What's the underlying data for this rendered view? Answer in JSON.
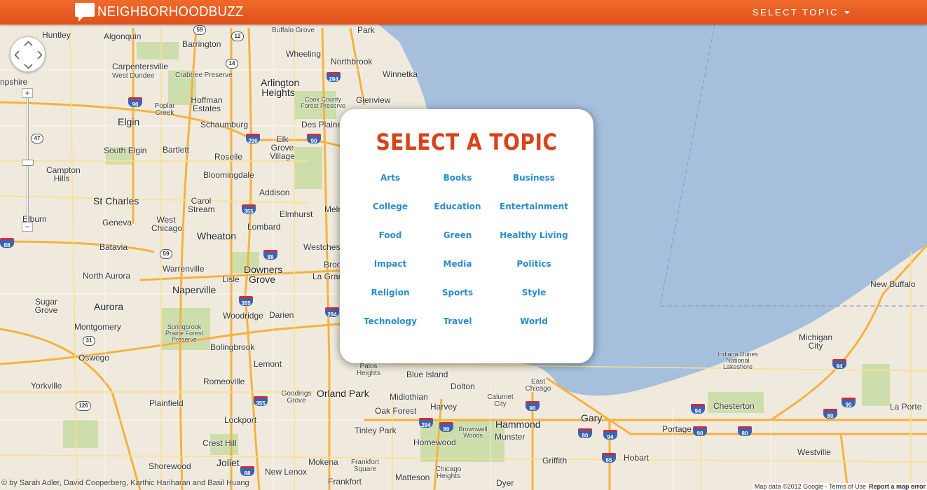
{
  "header": {
    "brand": "NEIGHBORHOODBUZZ",
    "topic_menu_label": "SELECT TOPIC"
  },
  "modal": {
    "title": "SELECT A TOPIC",
    "topics": [
      "Arts",
      "Books",
      "Business",
      "College",
      "Education",
      "Entertainment",
      "Food",
      "Green",
      "Healthy Living",
      "Impact",
      "Media",
      "Politics",
      "Religion",
      "Sports",
      "Style",
      "Technology",
      "Travel",
      "World"
    ]
  },
  "map": {
    "zoom_in_label": "+",
    "zoom_out_label": "−",
    "places": [
      "Huntley",
      "Algonquin",
      "Barrington",
      "Buffalo Grove",
      "Wheeling",
      "Northbrook",
      "Winnetka",
      "Glenview",
      "Park",
      "Carpentersville",
      "West Dundee",
      "Crabtree Preserve",
      "Arlington Heights",
      "Hoffman Estates",
      "Poplar Creek",
      "Cook County Forest Preserve",
      "Des Plaines",
      "npshire",
      "Elgin",
      "Schaumburg",
      "Elk Grove Village",
      "South Elgin",
      "Bartlett",
      "Roselle",
      "Campton Hills",
      "Bloomingdale",
      "Addison",
      "St Charles",
      "Carol Stream",
      "Elmhurst",
      "Melr",
      "Geneva",
      "West Chicago",
      "Lombard",
      "Elburn",
      "Wheaton",
      "Batavia",
      "Westches",
      "Warrenville",
      "Downers Grove",
      "Broo",
      "North Aurora",
      "Naperville",
      "Lisle",
      "La Gran",
      "Sugar Grove",
      "Aurora",
      "Woodridge",
      "Darien",
      "Montgomery",
      "Springbrook Prairie Forest Preserve",
      "Bolingbrook",
      "Oswego",
      "Lemont",
      "Palos Heights",
      "Blue Island",
      "Dolton",
      "Yorkville",
      "Romeoville",
      "Goodings Grove",
      "Orland Park",
      "Midlothian",
      "Calumet City",
      "East Chicago",
      "Plainfield",
      "Oak Forest",
      "Harvey",
      "Lockport",
      "Tinley Park",
      "Brownwell Woods",
      "Hammond",
      "Gary",
      "Homewood",
      "Munster",
      "Crest Hill",
      "Joliet",
      "Shorewood",
      "Mokena",
      "Frankfort Square",
      "Chicago Heights",
      "New Lenox",
      "Frankfort",
      "Matteson",
      "Dyer",
      "Griffith",
      "Hobart",
      "Portage",
      "Chesterton",
      "Westville",
      "Indiana Dunes National Lakeshore",
      "Michigan City",
      "La Porte",
      "New Buffalo"
    ],
    "shields": [
      "59",
      "12",
      "14",
      "294",
      "90",
      "290",
      "90",
      "47",
      "355",
      "88",
      "59",
      "88",
      "355",
      "294",
      "31",
      "126",
      "355",
      "294",
      "80",
      "90",
      "80",
      "94",
      "65",
      "94",
      "90",
      "80",
      "90",
      "94",
      "80",
      "88"
    ]
  },
  "footer": {
    "credits": "© by Sarah Adler, David Cooperberg, Karthic Hariharan and Basil Huang",
    "map_data": "Map data ©2012 Google - Terms of Use",
    "report": "Report a map error"
  },
  "colors": {
    "header_orange": "#e95a22",
    "title_red": "#d8431a",
    "link_blue": "#2a8ccc",
    "lake_blue": "#a5bfdd",
    "land": "#efeadd",
    "park_green": "#c7dca3",
    "highway": "#f4b23f"
  }
}
